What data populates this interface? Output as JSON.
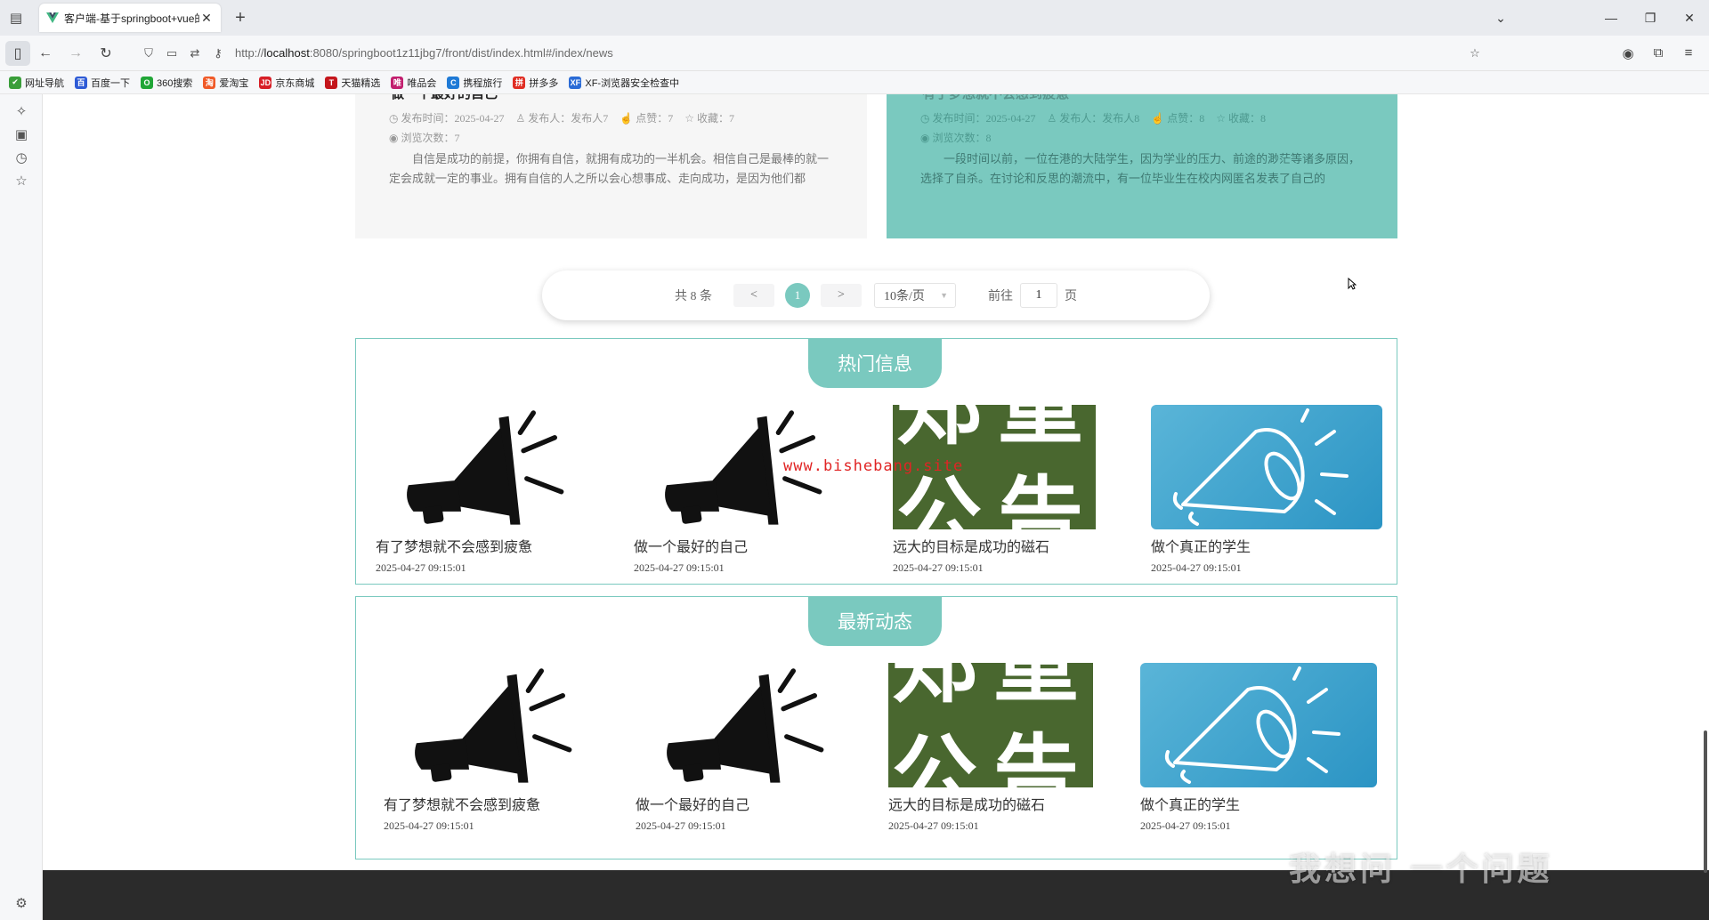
{
  "browser": {
    "tab_title": "客户端-基于springboot+vue的",
    "url_prefix": "http://",
    "url_host": "localhost",
    "url_rest": ":8080/springboot1z11jbg7/front/dist/index.html#/index/news",
    "bookmarks": [
      {
        "label": "网址导航",
        "color": "#3a9e3a",
        "glyph": "✔"
      },
      {
        "label": "百度一下",
        "color": "#2e5bd6",
        "glyph": "百"
      },
      {
        "label": "360搜索",
        "color": "#21a637",
        "glyph": "O"
      },
      {
        "label": "爱淘宝",
        "color": "#f05a28",
        "glyph": "淘"
      },
      {
        "label": "京东商城",
        "color": "#d71f27",
        "glyph": "JD"
      },
      {
        "label": "天猫精选",
        "color": "#c4161c",
        "glyph": "T"
      },
      {
        "label": "唯品会",
        "color": "#c21e6e",
        "glyph": "唯"
      },
      {
        "label": "携程旅行",
        "color": "#1f7ad6",
        "glyph": "C"
      },
      {
        "label": "拼多多",
        "color": "#e02e24",
        "glyph": "拼"
      },
      {
        "label": "XF-浏览器安全检查中",
        "color": "#2a6bd6",
        "glyph": "XF"
      }
    ]
  },
  "news_cards": [
    {
      "title": "做一个最好的自己",
      "publish_time_label": "发布时间：2025-04-27",
      "author_label": "发布人：发布人7",
      "likes_label": "点赞：7",
      "fav_label": "收藏：7",
      "views_label": "浏览次数：7",
      "body": "自信是成功的前提，你拥有自信，就拥有成功的一半机会。相信自己是最棒的就一定会成就一定的事业。拥有自信的人之所以会心想事成、走向成功，是因为他们都"
    },
    {
      "title": "有了梦想就不会感到疲惫",
      "publish_time_label": "发布时间：2025-04-27",
      "author_label": "发布人：发布人8",
      "likes_label": "点赞：8",
      "fav_label": "收藏：8",
      "views_label": "浏览次数：8",
      "body": "一段时间以前，一位在港的大陆学生，因为学业的压力、前途的渺茫等诸多原因，选择了自杀。在讨论和反思的潮流中，有一位毕业生在校内网匿名发表了自己的"
    }
  ],
  "pagination": {
    "total": "共 8 条",
    "prev": "<",
    "current": "1",
    "next": ">",
    "page_size": "10条/页",
    "goto_prefix": "前往",
    "goto_value": "1",
    "goto_suffix": "页"
  },
  "hot_section": {
    "title": "热门信息",
    "items": [
      {
        "title": "有了梦想就不会感到疲惫",
        "date": "2025-04-27 09:15:01",
        "image": "megaphone-black"
      },
      {
        "title": "做一个最好的自己",
        "date": "2025-04-27 09:15:01",
        "image": "megaphone-black"
      },
      {
        "title": "远大的目标是成功的磁石",
        "date": "2025-04-27 09:15:01",
        "image": "notice-green"
      },
      {
        "title": "做个真正的学生",
        "date": "2025-04-27 09:15:01",
        "image": "megaphone-blue"
      }
    ]
  },
  "new_section": {
    "title": "最新动态",
    "items": [
      {
        "title": "有了梦想就不会感到疲惫",
        "date": "2025-04-27 09:15:01",
        "image": "megaphone-black"
      },
      {
        "title": "做一个最好的自己",
        "date": "2025-04-27 09:15:01",
        "image": "megaphone-black"
      },
      {
        "title": "远大的目标是成功的磁石",
        "date": "2025-04-27 09:15:01",
        "image": "notice-green"
      },
      {
        "title": "做个真正的学生",
        "date": "2025-04-27 09:15:01",
        "image": "megaphone-blue"
      }
    ]
  },
  "notice_image_text": "郑重公告",
  "watermark": "www.bishebang.site",
  "overlay_text": "我想问 一个问题",
  "colors": {
    "accent": "#7ac9bf",
    "footer": "#2b2b2b",
    "watermark": "#e02424"
  }
}
